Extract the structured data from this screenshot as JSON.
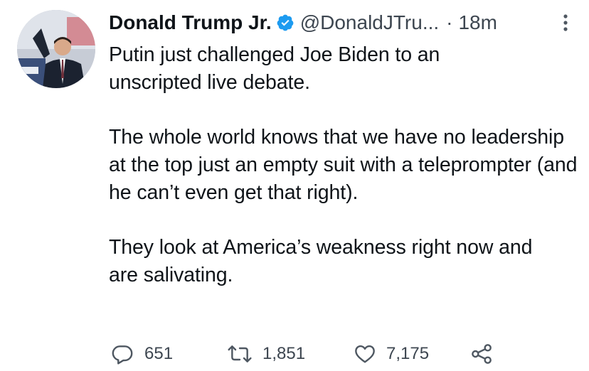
{
  "tweet": {
    "author_name": "Donald Trump Jr.",
    "handle": "@DonaldJTru...",
    "separator": "·",
    "time": "18m",
    "paragraphs": [
      "Putin just challenged Joe Biden to an unscripted live debate.",
      "The whole world knows that we have no leadership at the top just an empty suit with a teleprompter (and he can’t even get that right).",
      "They look at America’s weakness right now and are salivating."
    ],
    "actions": {
      "replies": "651",
      "retweets": "1,851",
      "likes": "7,175"
    }
  },
  "icons": {
    "verified": "verified-badge-icon",
    "more": "more-vertical-icon",
    "reply": "reply-bubble-icon",
    "retweet": "retweet-icon",
    "like": "heart-icon",
    "share": "share-icon"
  },
  "colors": {
    "verified_blue": "#1d9bf0",
    "text": "#0f1419",
    "secondary_text": "#3d4650"
  }
}
